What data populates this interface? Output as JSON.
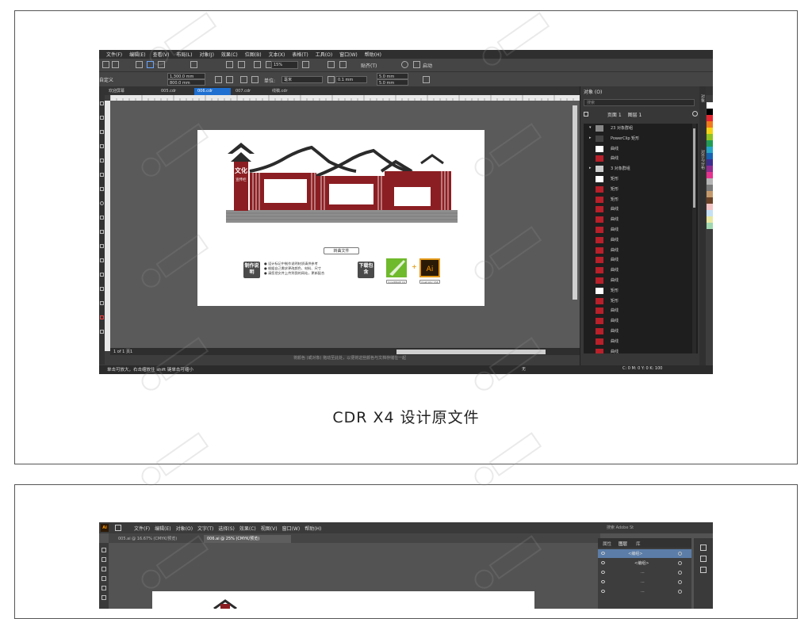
{
  "cdr": {
    "menu": [
      "文件(F)",
      "编辑(E)",
      "查看(V)",
      "布局(L)",
      "对象(J)",
      "效果(C)",
      "位图(B)",
      "文本(X)",
      "表格(T)",
      "工具(O)",
      "窗口(W)",
      "帮助(H)"
    ],
    "toolbar1": {
      "zoom": "15%",
      "snap": "贴齐(T)",
      "launch": "启动"
    },
    "toolbar2": {
      "preset": "自定义",
      "width": "1,300.0 mm",
      "height": "800.0 mm",
      "units_label": "单位:",
      "units": "毫米",
      "nudge": "0.1 mm",
      "dup_x": "5.0 mm",
      "dup_y": "5.0 mm"
    },
    "tabs": [
      {
        "label": "欢迎屏幕",
        "active": false
      },
      {
        "label": "005.cdr",
        "active": false
      },
      {
        "label": "006.cdr",
        "active": true
      },
      {
        "label": "007.cdr",
        "active": false
      },
      {
        "label": "线稿.cdr",
        "active": false
      }
    ],
    "page_nav": "1 of 1  页1",
    "status_hint": "将颜色 (或对象) 拖动至此处，以便将这些颜色与文档存储在一起",
    "status_left": "单击可放大，右击缩放住 shift 键单击可缩小",
    "status_right": "C: 0 M: 0 Y: 0 K: 100",
    "status_none": "无",
    "document": {
      "sign_title": "文化",
      "sign_subtitle": "宣传栏",
      "convert_button": "转曲文件",
      "instructions_badge": "制作说明",
      "instructions": [
        "● 设计标记中制作说明材质请供参考",
        "● 根据自己需求更改颜色、材料、尺寸",
        "● 请您把文件上传到我的网站，更新配合"
      ],
      "download_badge": "下载包含",
      "apps": [
        {
          "name": "CDR",
          "caption": "CorelDRAW X4",
          "color": "#6fba2c"
        },
        {
          "name": "Ai",
          "caption": "Illustrator CS6",
          "color": "#ff9a00"
        }
      ]
    },
    "objects_panel": {
      "title": "对象 (O)",
      "search_placeholder": "搜索",
      "page_label": "页面 1",
      "layer_label": "图层 1",
      "items": [
        {
          "label": "23 对象群组",
          "expand": "▾",
          "color": "#888888"
        },
        {
          "label": "PowerClip 矩形",
          "expand": "▸",
          "color": "#444444"
        },
        {
          "label": "曲线",
          "expand": "",
          "color": "#ffffff"
        },
        {
          "label": "曲线",
          "expand": "",
          "color": "#b8202a"
        },
        {
          "label": "3 对象群组",
          "expand": "▸",
          "color": "#cccccc"
        },
        {
          "label": "矩形",
          "expand": "",
          "color": "#ffffff"
        },
        {
          "label": "矩形",
          "expand": "",
          "color": "#b8202a"
        },
        {
          "label": "矩形",
          "expand": "",
          "color": "#b8202a"
        },
        {
          "label": "曲线",
          "expand": "",
          "color": "#b8202a"
        },
        {
          "label": "曲线",
          "expand": "",
          "color": "#b8202a"
        },
        {
          "label": "曲线",
          "expand": "",
          "color": "#b8202a"
        },
        {
          "label": "曲线",
          "expand": "",
          "color": "#b8202a"
        },
        {
          "label": "曲线",
          "expand": "",
          "color": "#b8202a"
        },
        {
          "label": "曲线",
          "expand": "",
          "color": "#b8202a"
        },
        {
          "label": "曲线",
          "expand": "",
          "color": "#b8202a"
        },
        {
          "label": "曲线",
          "expand": "",
          "color": "#b8202a"
        },
        {
          "label": "矩形",
          "expand": "",
          "color": "#ffffff"
        },
        {
          "label": "矩形",
          "expand": "",
          "color": "#b8202a"
        },
        {
          "label": "曲线",
          "expand": "",
          "color": "#b8202a"
        },
        {
          "label": "曲线",
          "expand": "",
          "color": "#b8202a"
        },
        {
          "label": "曲线",
          "expand": "",
          "color": "#b8202a"
        },
        {
          "label": "曲线",
          "expand": "",
          "color": "#b8202a"
        },
        {
          "label": "曲线",
          "expand": "",
          "color": "#b8202a"
        },
        {
          "label": "曲线",
          "expand": "",
          "color": "#b8202a"
        }
      ]
    },
    "dock_tabs": [
      "对象",
      "对齐与分布"
    ],
    "palette": [
      "#ffffff",
      "#000000",
      "#e6262f",
      "#f07a1a",
      "#f6d312",
      "#8fc31f",
      "#1f9d55",
      "#23a6c7",
      "#1663b3",
      "#3c2e8f",
      "#8e2d8f",
      "#e6328e",
      "#b5b5b5",
      "#7a7a7a",
      "#c49a6c",
      "#6b4226",
      "#f4c4c4",
      "#c4e0f4",
      "#e8e8a0",
      "#a0d8b0"
    ]
  },
  "caption1": "CDR X4 设计原文件",
  "ai": {
    "menu": [
      "文件(F)",
      "编辑(E)",
      "对象(O)",
      "文字(T)",
      "选择(S)",
      "效果(C)",
      "视图(V)",
      "窗口(W)",
      "帮助(H)"
    ],
    "search": "搜索 Adobe St",
    "tabs": [
      {
        "label": "005.ai @ 16.67% (CMYK/预览)",
        "active": false
      },
      {
        "label": "006.ai @ 25% (CMYK/预览)",
        "active": true
      }
    ],
    "panel_tabs": [
      "属性",
      "图层",
      "库"
    ],
    "layers": [
      {
        "name": "<编组>",
        "indent": 1
      },
      {
        "name": "<编组>",
        "indent": 2
      },
      {
        "name": "...",
        "indent": 3
      },
      {
        "name": "...",
        "indent": 3
      },
      {
        "name": "...",
        "indent": 3
      }
    ]
  },
  "colors": {
    "accent": "#1e6fd0",
    "brand_red": "#8b1e22",
    "roof": "#2b2b2b"
  }
}
